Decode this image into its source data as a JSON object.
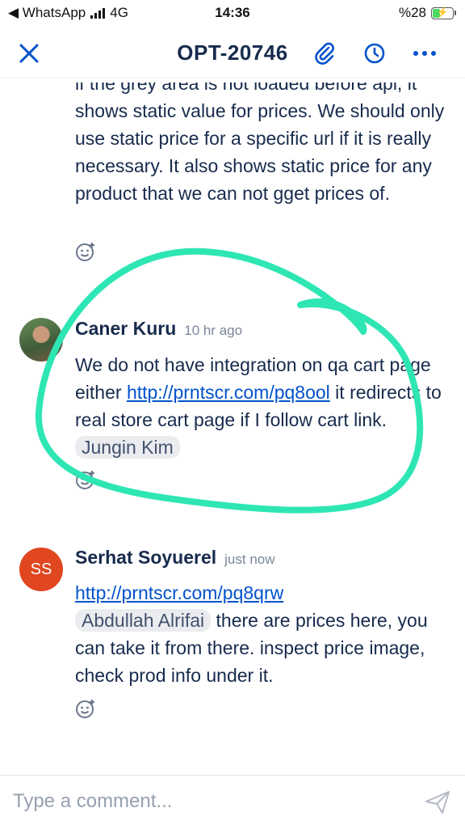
{
  "status_bar": {
    "back_app": "◀ WhatsApp",
    "network": "4G",
    "time": "14:36",
    "battery": "%28",
    "battery_level_percent": 28
  },
  "header": {
    "title": "OPT-20746",
    "icons": [
      "close-icon",
      "paperclip-icon",
      "clock-icon",
      "more-icon"
    ],
    "accent_color": "#0052cc"
  },
  "comments": [
    {
      "text": "if the grey area is not loaded before api, it shows static value for prices. We should only use static price for a specific url if it is really necessary. It also shows static price for any product that we can not gget prices of."
    },
    {
      "author": "Caner Kuru",
      "time_ago": "10 hr ago",
      "text_before_link": "We do not have integration on qa cart page either ",
      "link": "http://prntscr.com/pq8ool",
      "text_after_link": " it redirects to real store cart page if I follow cart link. ",
      "mention": "Jungin Kim"
    },
    {
      "author": "Serhat Soyuerel",
      "initials": "SS",
      "avatar_color": "#e0461f",
      "time_ago": "just now",
      "link": "http://prntscr.com/pq8qrw",
      "mention": "Abdullah Alrifai",
      "text_after_mention": " there are prices here, you can take it from there. inspect price image, check prod info under it."
    }
  ],
  "composer": {
    "placeholder": "Type a comment..."
  },
  "annotation_color": "#2ee6b4"
}
